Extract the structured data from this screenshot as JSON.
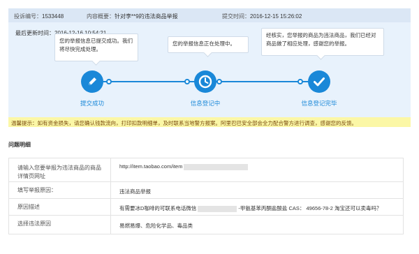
{
  "header": {
    "id_label": "投诉编号：",
    "id_value": "1533448",
    "summary_label": "内容概要：",
    "summary_value": "针对李**9的违法商品举报",
    "submit_label": "提交时间：",
    "submit_value": "2016-12-15 15:26:02"
  },
  "progress": {
    "updated": "最后更新时间：2016-12-16 10:54:21",
    "bubbles": [
      "您的举报信息已提交成功。我们将尽快完成处理。",
      "您的举报信息正在处理中。",
      "经核实，您举报的商品为违法商品，我们已经对商品做了相应处理，感谢您的举报。"
    ],
    "steps": [
      {
        "label": "提交成功",
        "icon": "pencil-icon"
      },
      {
        "label": "信息登记中",
        "icon": "clock-icon"
      },
      {
        "label": "信息登记完毕",
        "icon": "check-icon"
      }
    ],
    "accent": "#1a88d8"
  },
  "warning": "温馨提示：如有资金损失，请您确认钱款流向，打印扣款明细单，及时联系当地警方报案。阿里巴巴安全部会全力配合警方进行调查，感谢您的反馈。",
  "section_title": "问题明细",
  "details": [
    {
      "label": "请输入您要举报为违法商品的商品详情页网址",
      "value_prefix": "http://item.taobao.com/item",
      "value_suffix": ""
    },
    {
      "label": "填写举报原因：",
      "value_prefix": "违法商品举报",
      "value_suffix": ""
    },
    {
      "label": "原因描述",
      "value_prefix": "有需要冰D咖啡的可联系电话微信",
      "value_suffix": "-甲氨基苯丙酮盐酸盐 CAS： 49656-78-2 淘宝还可以卖毒吗？"
    },
    {
      "label": "选择违法原因",
      "value_prefix": "易燃易爆、危险化学品、毒品类",
      "value_suffix": ""
    }
  ]
}
